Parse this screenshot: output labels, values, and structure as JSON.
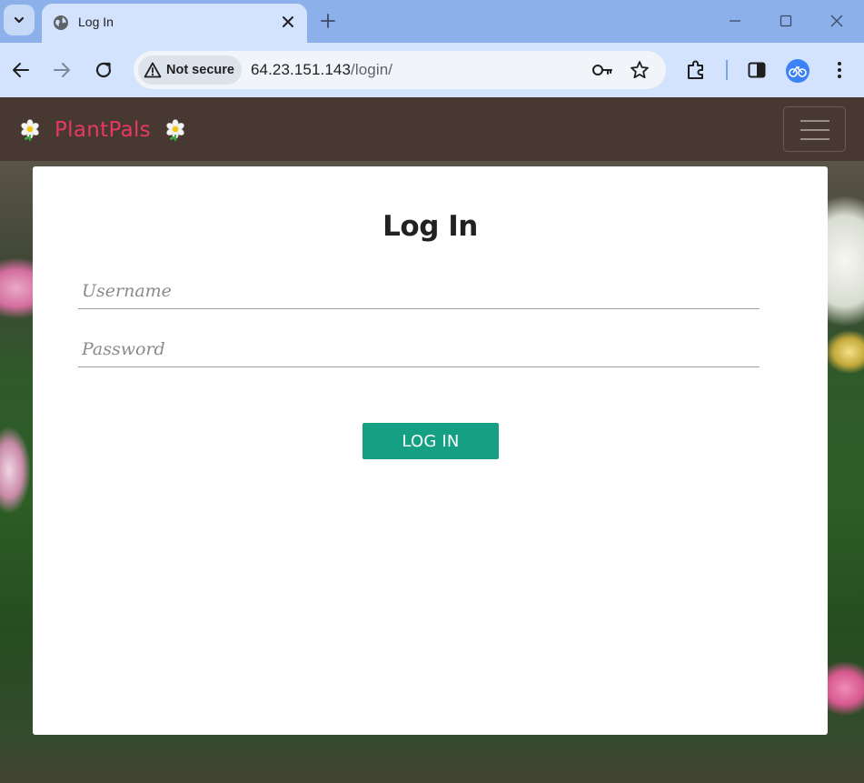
{
  "browser": {
    "tab": {
      "title": "Log In"
    },
    "address_bar": {
      "security_label": "Not secure",
      "url_host": "64.23.151.143",
      "url_path": "/login/"
    }
  },
  "site": {
    "brand": {
      "name": "PlantPals"
    }
  },
  "login_form": {
    "title": "Log In",
    "username": {
      "placeholder": "Username",
      "value": ""
    },
    "password": {
      "placeholder": "Password",
      "value": ""
    },
    "submit_label": "LOG IN"
  },
  "colors": {
    "navbar": "#473932",
    "brand_text": "#e8385f",
    "button": "#16a083",
    "tabstrip": "#8cb0ea",
    "toolbar": "#d3e3fd"
  }
}
